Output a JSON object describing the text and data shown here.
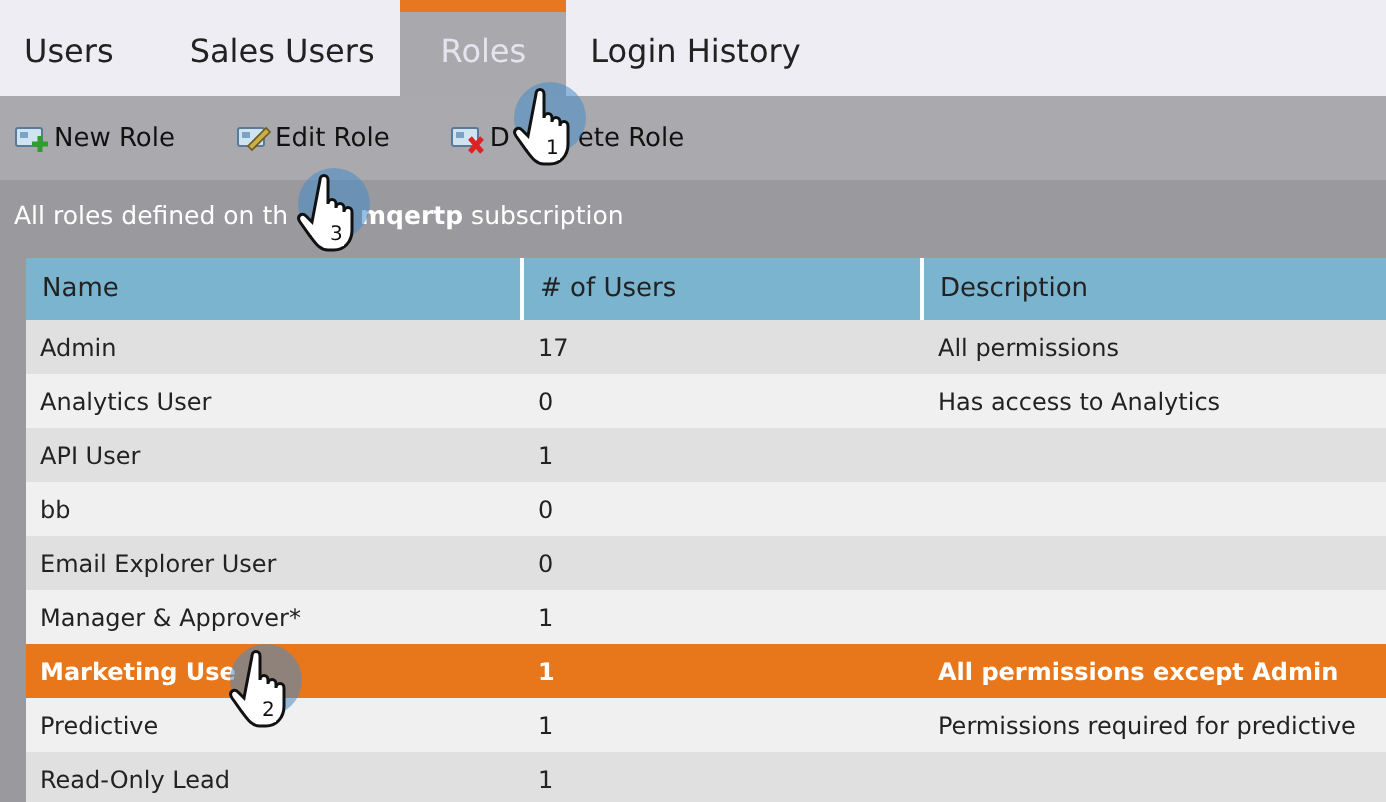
{
  "tabs": [
    {
      "label": "Users",
      "selected": false
    },
    {
      "label": "Sales Users",
      "selected": false
    },
    {
      "label": "Roles",
      "selected": true
    },
    {
      "label": "Login History",
      "selected": false
    }
  ],
  "toolbar": [
    {
      "kind": "new",
      "label": "New Role"
    },
    {
      "kind": "edit",
      "label": "Edit Role"
    },
    {
      "kind": "delete",
      "label_parts": [
        "D",
        "ete Role"
      ]
    }
  ],
  "subtitle_parts": [
    "All roles defined on th",
    "**mqertp** subscription"
  ],
  "table": {
    "columns": [
      "Name",
      "# of Users",
      "Description"
    ],
    "rows": [
      {
        "name": "Admin",
        "users": "17",
        "description": "All permissions",
        "selected": false
      },
      {
        "name": "Analytics User",
        "users": "0",
        "description": "Has access to Analytics",
        "selected": false
      },
      {
        "name": "API User",
        "users": "1",
        "selected": false
      },
      {
        "name": "bb",
        "users": "0",
        "selected": false
      },
      {
        "name": "Email Explorer User",
        "users": "0",
        "selected": false
      },
      {
        "name": "Manager & Approver*",
        "users": "1",
        "selected": false
      },
      {
        "name": "Marketing Use",
        "users": "1",
        "description": "All permissions except Admin",
        "selected": true
      },
      {
        "name": "Predictive",
        "users": "1",
        "description": "Permissions required for predictive",
        "selected": false
      },
      {
        "name": "Read-Only Lead",
        "users": "1",
        "selected": false
      }
    ]
  },
  "callouts": [
    {
      "number": "1"
    },
    {
      "number": "2"
    },
    {
      "number": "3"
    }
  ]
}
